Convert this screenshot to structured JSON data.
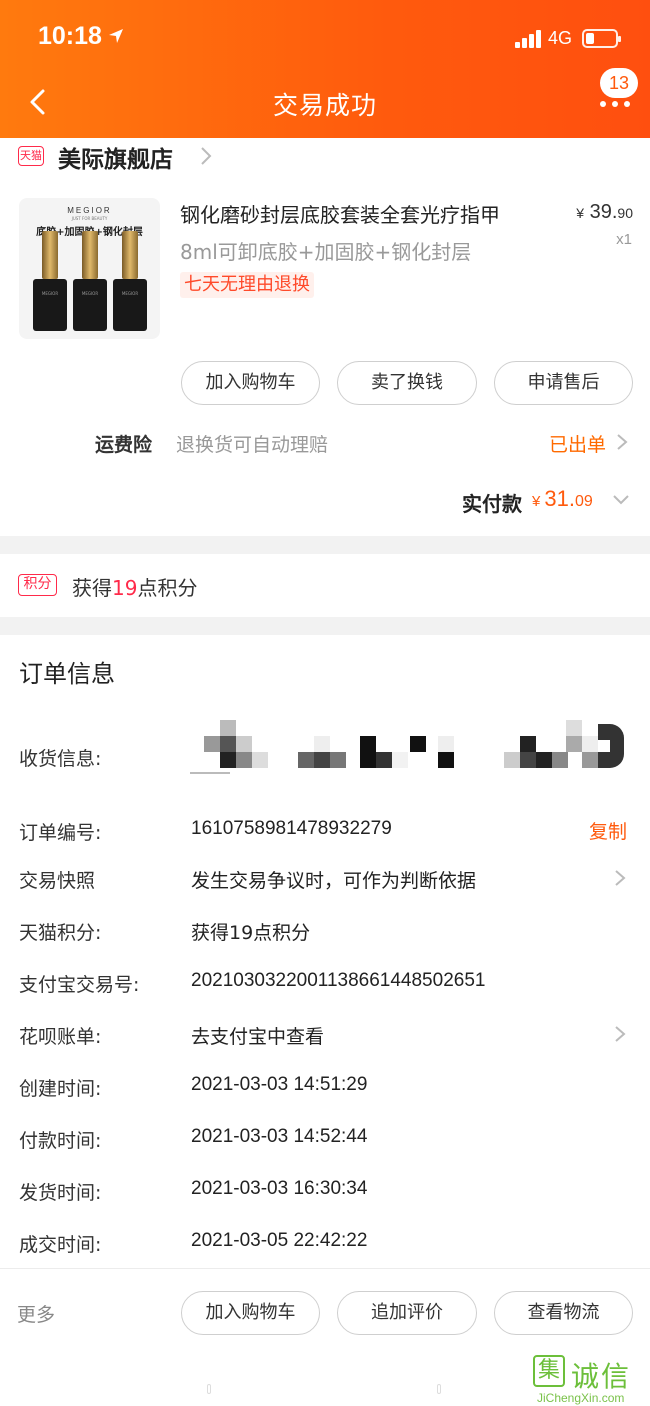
{
  "status_bar": {
    "time": "10:18",
    "network": "4G"
  },
  "header": {
    "back_label": "",
    "title": "交易成功",
    "badge_count": "13"
  },
  "store": {
    "badge": "天猫",
    "name": "美际旗舰店"
  },
  "product": {
    "image_brand": "MEGIOR",
    "image_brand_sub": "JUST FOR BEAUTY",
    "image_caption": "底胶+加固胶+钢化封层",
    "bottle_label": "MEGIOR",
    "title": "钢化磨砂封层底胶套装全套光疗指甲",
    "spec": "8ml可卸底胶+加固胶+钢化封层",
    "tag": "七天无理由退换",
    "price_currency": "¥",
    "price_int": "39.",
    "price_dec": "90",
    "quantity": "x1"
  },
  "actions": {
    "add_to_cart": "加入购物车",
    "resell": "卖了换钱",
    "after_sale": "申请售后"
  },
  "insurance": {
    "label": "运费险",
    "description": "退换货可自动理赔",
    "status": "已出单"
  },
  "paid": {
    "label": "实付款",
    "currency": "¥",
    "int": "31.",
    "dec": "09"
  },
  "points": {
    "badge": "积分",
    "prefix": "获得",
    "value": "19",
    "suffix": "点积分"
  },
  "order_info": {
    "title": "订单信息",
    "rows": [
      {
        "label": "收货信息:",
        "value": ""
      },
      {
        "label": "订单编号:",
        "value": "1610758981478932279",
        "action": "复制"
      },
      {
        "label": "交易快照",
        "value": "发生交易争议时，可作为判断依据"
      },
      {
        "label": "天猫积分:",
        "value": "获得19点积分"
      },
      {
        "label": "支付宝交易号:",
        "value": "2021030322001138661448502651"
      },
      {
        "label": "花呗账单:",
        "value": "去支付宝中查看"
      },
      {
        "label": "创建时间:",
        "value": "2021-03-03 14:51:29"
      },
      {
        "label": "付款时间:",
        "value": "2021-03-03 14:52:44"
      },
      {
        "label": "发货时间:",
        "value": "2021-03-03 16:30:34"
      },
      {
        "label": "成交时间:",
        "value": "2021-03-05 22:42:22"
      }
    ]
  },
  "bottom_bar": {
    "more": "更多",
    "add_to_cart": "加入购物车",
    "add_review": "追加评价",
    "view_logistics": "查看物流"
  },
  "watermark": {
    "glyph": "集",
    "cn": "诚信",
    "en": "JiChengXin.com"
  },
  "colors": {
    "header_start": "#ff7a0e",
    "header_end": "#ff4f0f",
    "accent": "#ff5a0d",
    "tmall_red": "#ff2a4a"
  }
}
